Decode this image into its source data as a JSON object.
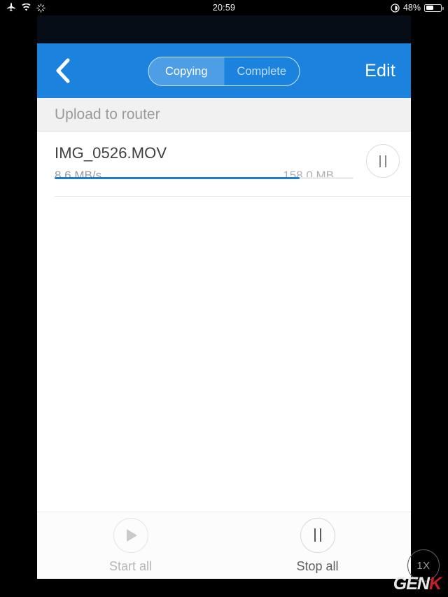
{
  "status_bar": {
    "airplane_icon": "airplane-icon",
    "wifi_icon": "wifi-icon",
    "activity_icon": "activity-spinner-icon",
    "time": "20:59",
    "lock_icon": "rotation-lock-icon",
    "battery_percent": "48%",
    "battery_level": 48
  },
  "nav": {
    "back_icon": "chevron-left-icon",
    "segments": [
      {
        "label": "Copying",
        "selected": true
      },
      {
        "label": "Complete",
        "selected": false
      }
    ],
    "edit_label": "Edit"
  },
  "section": {
    "header": "Upload to router"
  },
  "transfers": [
    {
      "name": "IMG_0526.MOV",
      "speed": "8.6 MB/s",
      "size": "158.0 MB",
      "progress": 82,
      "action_icon": "pause-icon"
    }
  ],
  "toolbar": {
    "start_all": {
      "label": "Start all",
      "icon": "play-icon",
      "enabled": false
    },
    "stop_all": {
      "label": "Stop all",
      "icon": "pause-icon",
      "enabled": true
    }
  },
  "watermark": {
    "zoom_badge": "1X",
    "brand_first": "GEN",
    "brand_last": "K"
  },
  "colors": {
    "accent_blue": "#1b83dd",
    "progress_blue": "#1b7fce",
    "section_bg": "#f1f1f1",
    "brand_red": "#c81f27"
  }
}
